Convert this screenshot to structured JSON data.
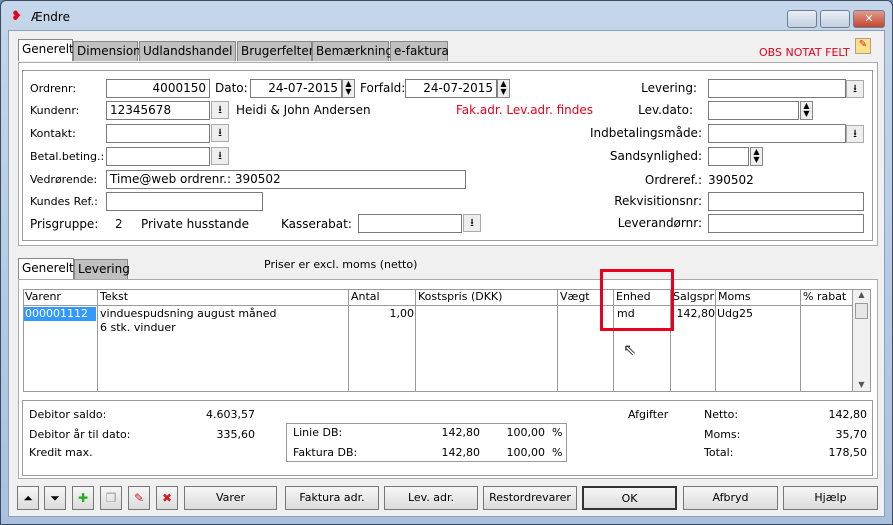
{
  "window": {
    "title": "Ændre",
    "minimize": "▭",
    "maximize": "□",
    "close": "✕"
  },
  "tabs": [
    "Generelt",
    "Dimension",
    "Udlandshandel",
    "Brugerfelter",
    "Bemærkning",
    "e-faktura"
  ],
  "obs": "OBS NOTAT FELT",
  "form": {
    "ordrenr_label": "Ordrenr:",
    "ordrenr": "4000150",
    "dato_label": "Dato:",
    "dato": "24-07-2015",
    "forfald_label": "Forfald:",
    "forfald": "24-07-2015",
    "kundenr_label": "Kundenr:",
    "kundenr": "12345678",
    "kundenavn": "Heidi & John Andersen",
    "adr_notice": "Fak.adr. Lev.adr. findes",
    "kontakt_label": "Kontakt:",
    "kontakt": "",
    "betal_label": "Betal.beting.:",
    "betal": "",
    "vedr_label": "Vedrørende:",
    "vedr": "Time@web ordrenr.: 390502",
    "kundesref_label": "Kundes Ref.:",
    "kundesref": "",
    "prisgruppe_label": "Prisgruppe:",
    "prisgruppe": "2",
    "prisgruppe_name": "Private husstande",
    "kasserabat_label": "Kasserabat:",
    "kasserabat": "",
    "levering_label": "Levering:",
    "levering": "",
    "levdato_label": "Lev.dato:",
    "levdato": "",
    "indbetaling_label": "Indbetalingsmåde:",
    "indbetaling": "",
    "sandsyn_label": "Sandsynlighed:",
    "sandsyn": "",
    "ordreref_label": "Ordreref.:",
    "ordreref": "390502",
    "rekv_label": "Rekvisitionsnr:",
    "rekv": "",
    "leverandor_label": "Leverandørnr:",
    "leverandor": ""
  },
  "subtabs": [
    "Generelt",
    "Levering"
  ],
  "price_note": "Priser er excl. moms (netto)",
  "grid": {
    "headers": [
      "Varenr",
      "Tekst",
      "Antal",
      "Kostspris (DKK)",
      "Vægt",
      "Enhed",
      "Salgspr",
      "Moms",
      "% rabat"
    ],
    "row": {
      "varenr": "000001112",
      "tekst1": "vinduespudsning august måned",
      "tekst2": "6 stk. vinduer",
      "antal": "1,00",
      "kostpris": "",
      "vaegt": "",
      "enhed": "md",
      "salgspr": "142,80",
      "moms": "Udg25",
      "rabat": ""
    }
  },
  "summary": {
    "saldo_label": "Debitor saldo:",
    "saldo": "4.603,57",
    "aar_label": "Debitor år til dato:",
    "aar": "335,60",
    "kredit_label": "Kredit max.",
    "kredit": "",
    "linie_label": "Linie DB:",
    "linie_val": "142,80",
    "linie_pct": "100,00",
    "pct": "%",
    "faktura_label": "Faktura DB:",
    "faktura_val": "142,80",
    "faktura_pct": "100,00",
    "afgifter": "Afgifter",
    "netto_label": "Netto:",
    "netto": "142,80",
    "moms_label": "Moms:",
    "moms": "35,70",
    "total_label": "Total:",
    "total": "178,50"
  },
  "buttons": {
    "varer": "Varer",
    "faktura": "Faktura adr.",
    "lev": "Lev. adr.",
    "restordre": "Restordrevarer",
    "ok": "OK",
    "afbryd": "Afbryd",
    "hjaelp": "Hjælp"
  },
  "colors": {
    "highlight": "#e8001c",
    "selection": "#3399ff"
  }
}
